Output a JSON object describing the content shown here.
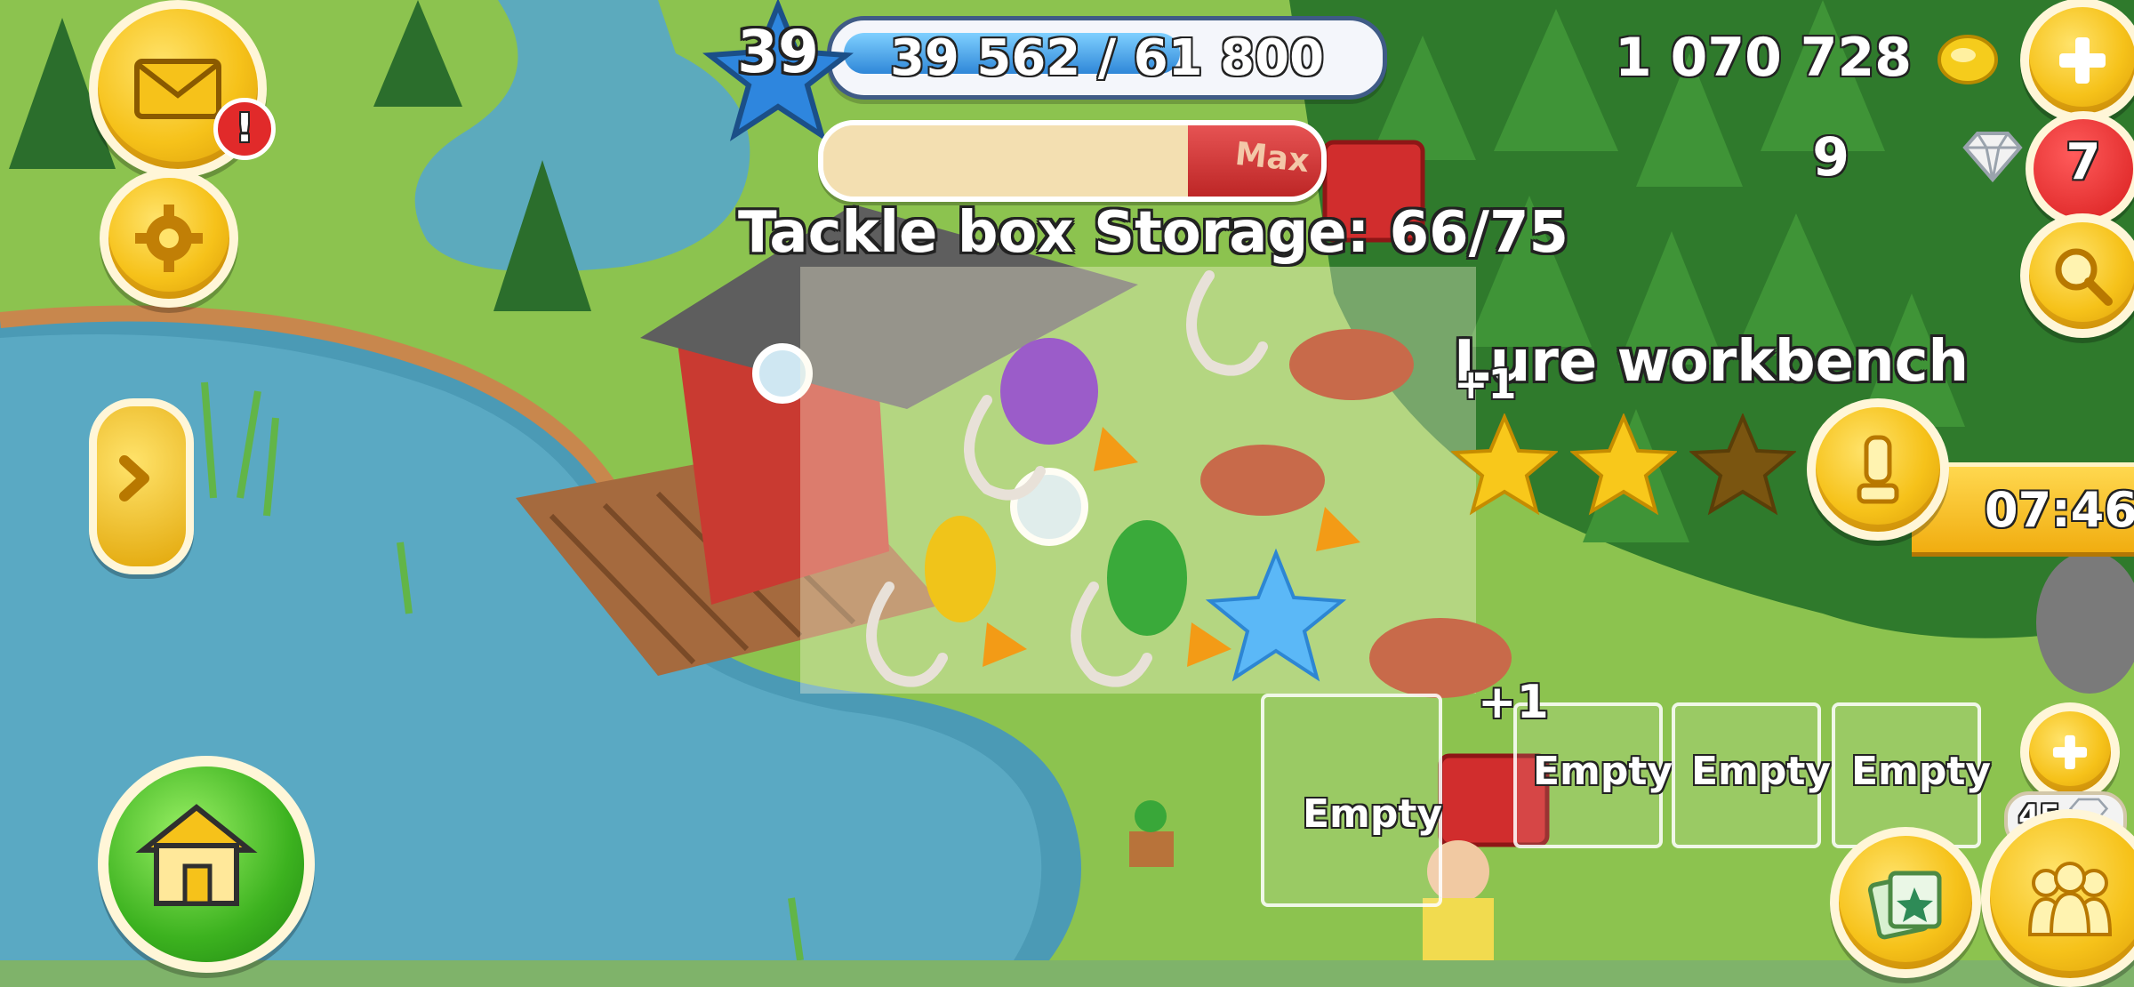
{
  "hud": {
    "level": "39",
    "xp_text": "39 562 / 61 800",
    "xp_progress": 0.64,
    "coins": "1 070 728",
    "gems": "9",
    "gem_badge": "7",
    "mail_alert": "!",
    "slot_count": "45"
  },
  "storage": {
    "label": "Tackle box Storage: 66/75",
    "progress": 0.88,
    "max_label": "Max"
  },
  "building": {
    "title": "Lure workbench",
    "stars_earned": 2,
    "stars_total": 3,
    "timer": "07:46",
    "plus_one_a": "+1",
    "plus_one_b": "+1"
  },
  "slots": [
    {
      "label": "Empty"
    },
    {
      "label": "Empty"
    },
    {
      "label": "Empty"
    },
    {
      "label": "Empty"
    }
  ],
  "icons": {
    "mail": "mail-icon",
    "settings": "gear-icon",
    "expand": "chevron-right-icon",
    "home": "house-icon",
    "coin": "coin-icon",
    "gem": "diamond-icon",
    "search": "magnifier-icon",
    "info": "info-icon",
    "friends": "friends-icon",
    "decor": "decorations-icon"
  },
  "colors": {
    "button_gold": "#f6c21a",
    "button_green": "#3cb21f",
    "xp_blue": "#2f87d8",
    "alert_red": "#d81d1d"
  }
}
